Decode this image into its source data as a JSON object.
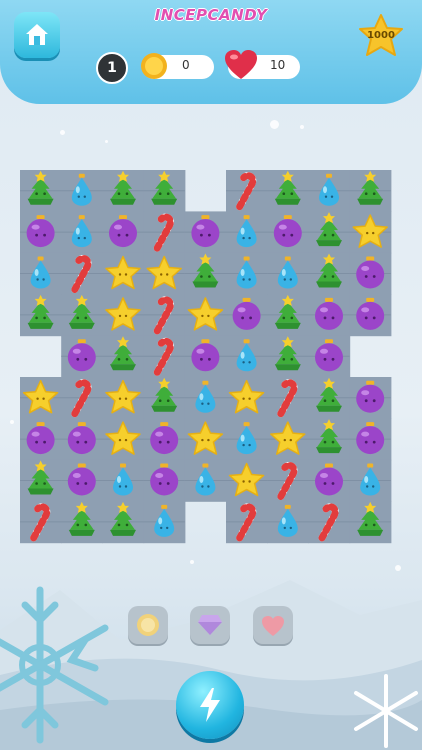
{
  "header": {
    "title": "INCEPCANDY"
  },
  "hud": {
    "moves": "1",
    "coins": "0",
    "lives": "10",
    "target_score": "1000"
  },
  "board": {
    "cols": 9,
    "rows": 9,
    "grid": [
      [
        "tree",
        "drop",
        "tree",
        "tree",
        "",
        "cane",
        "tree",
        "drop",
        "tree"
      ],
      [
        "orb",
        "drop",
        "orb",
        "cane",
        "orb",
        "drop",
        "orb",
        "tree",
        "star"
      ],
      [
        "drop",
        "cane",
        "star",
        "star",
        "tree",
        "drop",
        "drop",
        "tree",
        "orb"
      ],
      [
        "tree",
        "tree",
        "star",
        "cane",
        "star",
        "orb",
        "tree",
        "orb",
        "orb"
      ],
      [
        "",
        "orb",
        "tree",
        "cane",
        "orb",
        "drop",
        "tree",
        "orb",
        ""
      ],
      [
        "star",
        "cane",
        "star",
        "tree",
        "drop",
        "star",
        "cane",
        "tree",
        "orb"
      ],
      [
        "orb",
        "orb",
        "star",
        "orb",
        "star",
        "drop",
        "star",
        "tree",
        "orb"
      ],
      [
        "tree",
        "orb",
        "drop",
        "orb",
        "drop",
        "star",
        "cane",
        "orb",
        "drop"
      ],
      [
        "cane",
        "tree",
        "tree",
        "drop",
        "",
        "cane",
        "drop",
        "cane",
        "tree"
      ]
    ]
  },
  "boosters": [
    {
      "name": "coin-booster",
      "icon": "coin-icon"
    },
    {
      "name": "gem-booster",
      "icon": "gem-icon"
    },
    {
      "name": "heart-booster",
      "icon": "heart-icon"
    }
  ],
  "colors": {
    "tree": "#3fae3a",
    "drop": "#39b3e6",
    "orb": "#9b45c9",
    "star": "#f6cf2c",
    "cane": "#e23c3c",
    "tile": "#8e9fb2"
  }
}
